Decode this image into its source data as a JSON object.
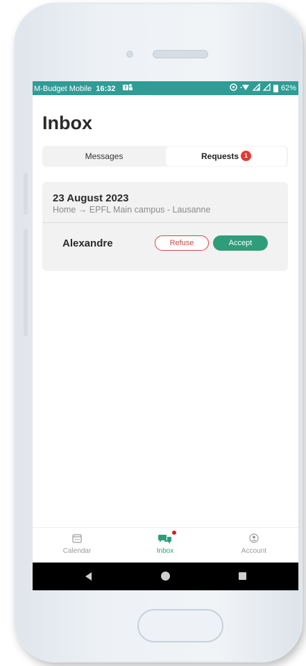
{
  "status_bar": {
    "carrier": "M-Budget Mobile",
    "time": "16:32",
    "notification_icon": "teams-icon",
    "battery": "62%"
  },
  "page": {
    "title": "Inbox"
  },
  "tabs": [
    {
      "label": "Messages",
      "selected": false
    },
    {
      "label": "Requests",
      "selected": true,
      "badge": "1"
    }
  ],
  "request": {
    "date": "23 August 2023",
    "route": "Home → EPFL Main campus - Lausanne",
    "name": "Alexandre",
    "refuse_label": "Refuse",
    "accept_label": "Accept"
  },
  "bottom_nav": [
    {
      "label": "Calendar",
      "icon": "calendar-icon",
      "active": false
    },
    {
      "label": "Inbox",
      "icon": "chat-icon",
      "active": true
    },
    {
      "label": "Account",
      "icon": "account-icon",
      "active": false
    }
  ],
  "colors": {
    "status_bar": "#2f9d95",
    "accent": "#2f9d7a",
    "refuse": "#d64545",
    "badge": "#e53935"
  }
}
